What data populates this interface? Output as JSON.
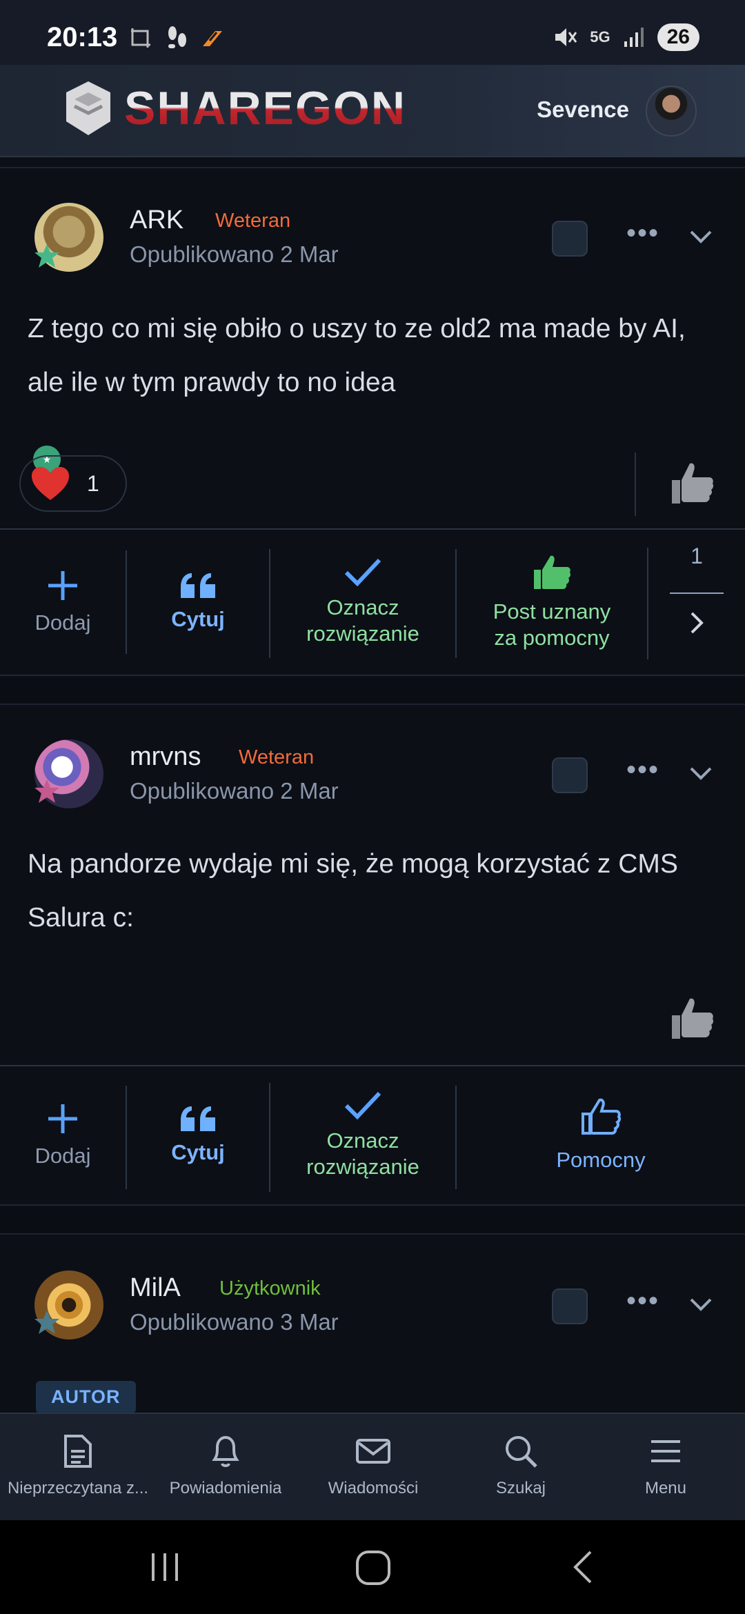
{
  "status_bar": {
    "time": "20:13",
    "network": "5G",
    "battery": "26",
    "icons": [
      "screenshot-icon",
      "steps-icon",
      "app-icon",
      "mute-icon",
      "signal-icon"
    ]
  },
  "header": {
    "logo": "SHAREGON",
    "username": "Sevence"
  },
  "posts": [
    {
      "author": "ARK",
      "role": "Weteran",
      "role_color": "#f26b3a",
      "date": "Opublikowano 2 Mar",
      "body": "Z tego co mi się obiło o uszy to ze old2 ma made by AI, ale ile w tym prawdy to no idea",
      "reaction_count": "1",
      "actions": {
        "add": "Dodaj",
        "quote": "Cytuj",
        "mark_solution": "Oznacz rozwiązanie",
        "helpful": "Post uznany za pomocny",
        "helpful_count": "1"
      }
    },
    {
      "author": "mrvns",
      "role": "Weteran",
      "role_color": "#f26b3a",
      "date": "Opublikowano 2 Mar",
      "body": "Na pandorze wydaje mi się, że mogą korzystać z CMS Salura c:",
      "actions": {
        "add": "Dodaj",
        "quote": "Cytuj",
        "mark_solution": "Oznacz rozwiązanie",
        "helpful": "Pomocny"
      }
    },
    {
      "author": "MilA",
      "role": "Użytkownik",
      "role_color": "#6fbf3c",
      "date": "Opublikowano 3 Mar",
      "badge": "AUTOR"
    }
  ],
  "bottom_nav": [
    {
      "label": "Nieprzeczytana z...",
      "icon": "document-icon"
    },
    {
      "label": "Powiadomienia",
      "icon": "bell-icon"
    },
    {
      "label": "Wiadomości",
      "icon": "mail-icon"
    },
    {
      "label": "Szukaj",
      "icon": "search-icon"
    },
    {
      "label": "Menu",
      "icon": "menu-icon"
    }
  ]
}
